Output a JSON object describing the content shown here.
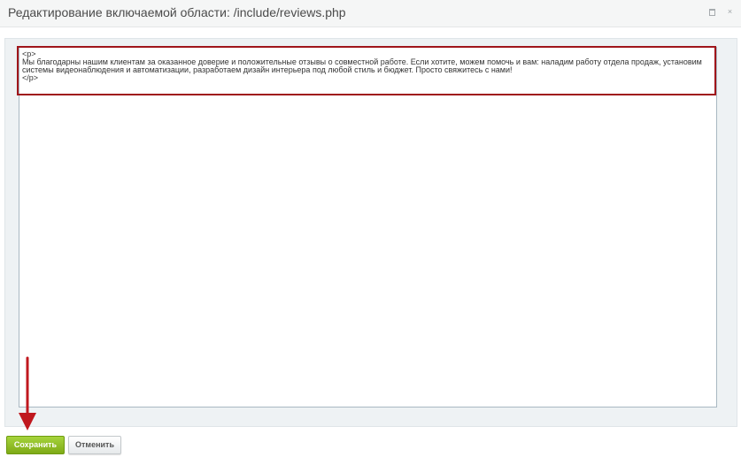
{
  "dialog": {
    "title": "Редактирование включаемой области: /include/reviews.php"
  },
  "editor": {
    "content": "<p>\nМы благодарны нашим клиентам за оказанное доверие и положительные отзывы о совместной работе. Если хотите, можем помочь и вам: наладим работу отдела продаж, установим системы видеонаблюдения и автоматизации, разработаем дизайн интерьера под любой стиль и бюджет. Просто свяжитесь с нами!\n</p>"
  },
  "footer": {
    "save_label": "Сохранить",
    "cancel_label": "Отменить"
  },
  "icons": {
    "restore": "restore-icon",
    "close": "close-icon"
  },
  "colors": {
    "highlight": "#a0161b",
    "save_button": "#8fbc22",
    "arrow": "#c0181e"
  }
}
